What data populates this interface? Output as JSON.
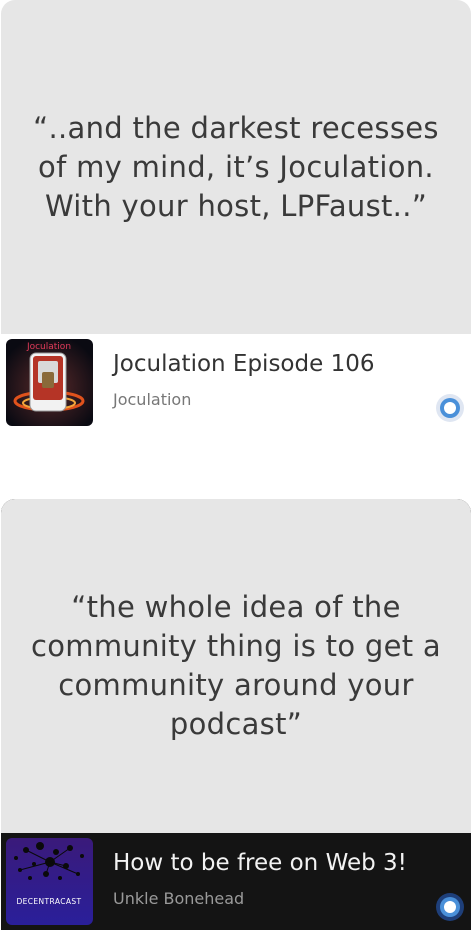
{
  "cards": [
    {
      "quote": "“..and the darkest recesses of my mind, it’s Joculation. With your host, LPFaust..”",
      "episode_title": "Joculation Episode 106",
      "show_name": "Joculation",
      "cover_label": "Joculation",
      "cover_icon": "joculation-cover-art",
      "status_icon": "light-ring-indicator"
    },
    {
      "quote": "“the whole idea of the community thing is to get a community around your podcast”",
      "episode_title": "How to be free on Web 3!",
      "show_name": "Unkle Bonehead",
      "cover_label": "DECENTRACAST",
      "cover_icon": "decentracast-cover-art",
      "status_icon": "dark-ring-indicator"
    }
  ],
  "colors": {
    "quote_bg": "#e6e6e6",
    "quote_text": "#3a3a3a",
    "card1_bg": "#ffffff",
    "card2_bg": "#141414",
    "indicator_blue": "#4a90d9"
  }
}
